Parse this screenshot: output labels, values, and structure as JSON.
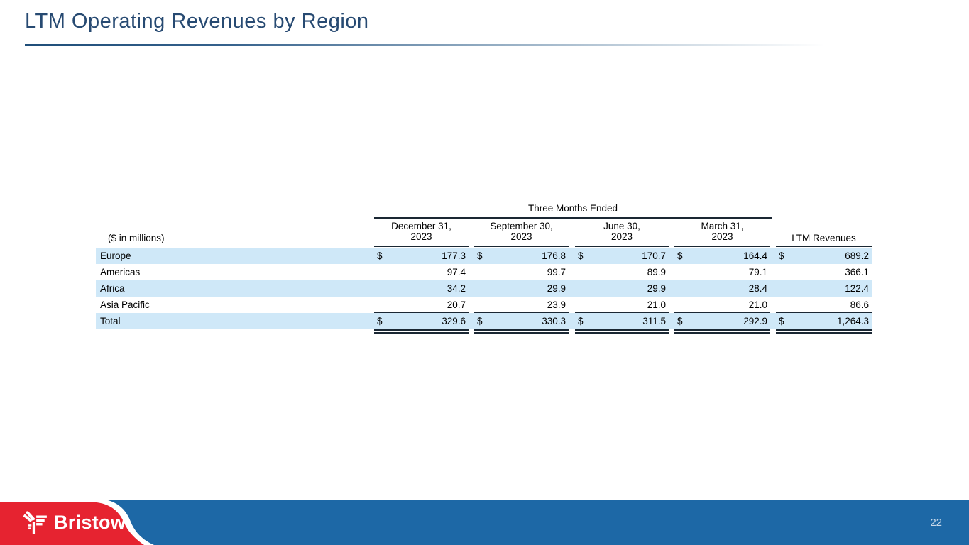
{
  "title": "LTM Operating Revenues by Region",
  "footer": {
    "brand": "Bristow",
    "page_number": "22"
  },
  "colors": {
    "title_blue": "#274a72",
    "row_stripe": "#cfe8f8",
    "table_line": "#1a2733",
    "footer_blue": "#1d68a6",
    "brand_red": "#e62330"
  },
  "chart_data": {
    "type": "table",
    "title": "LTM Operating Revenues by Region",
    "units_label": "($ in millions)",
    "group_header": "Three Months Ended",
    "columns": [
      {
        "line1": "December 31,",
        "line2": "2023"
      },
      {
        "line1": "September 30,",
        "line2": "2023"
      },
      {
        "line1": "June 30,",
        "line2": "2023"
      },
      {
        "line1": "March 31,",
        "line2": "2023"
      }
    ],
    "ltm_column_label": "LTM Revenues",
    "rows": [
      {
        "label": "Europe",
        "dollar": "$",
        "q_dec": "177.3",
        "q_sep": "176.8",
        "q_jun": "170.7",
        "q_mar": "164.4",
        "ltm": "689.2"
      },
      {
        "label": "Americas",
        "q_dec": "97.4",
        "q_sep": "99.7",
        "q_jun": "89.9",
        "q_mar": "79.1",
        "ltm": "366.1"
      },
      {
        "label": "Africa",
        "q_dec": "34.2",
        "q_sep": "29.9",
        "q_jun": "29.9",
        "q_mar": "28.4",
        "ltm": "122.4"
      },
      {
        "label": "Asia Pacific",
        "q_dec": "20.7",
        "q_sep": "23.9",
        "q_jun": "21.0",
        "q_mar": "21.0",
        "ltm": "86.6"
      },
      {
        "label": "Total",
        "dollar": "$",
        "q_dec": "329.6",
        "q_sep": "330.3",
        "q_jun": "311.5",
        "q_mar": "292.9",
        "ltm": "1,264.3"
      }
    ]
  }
}
